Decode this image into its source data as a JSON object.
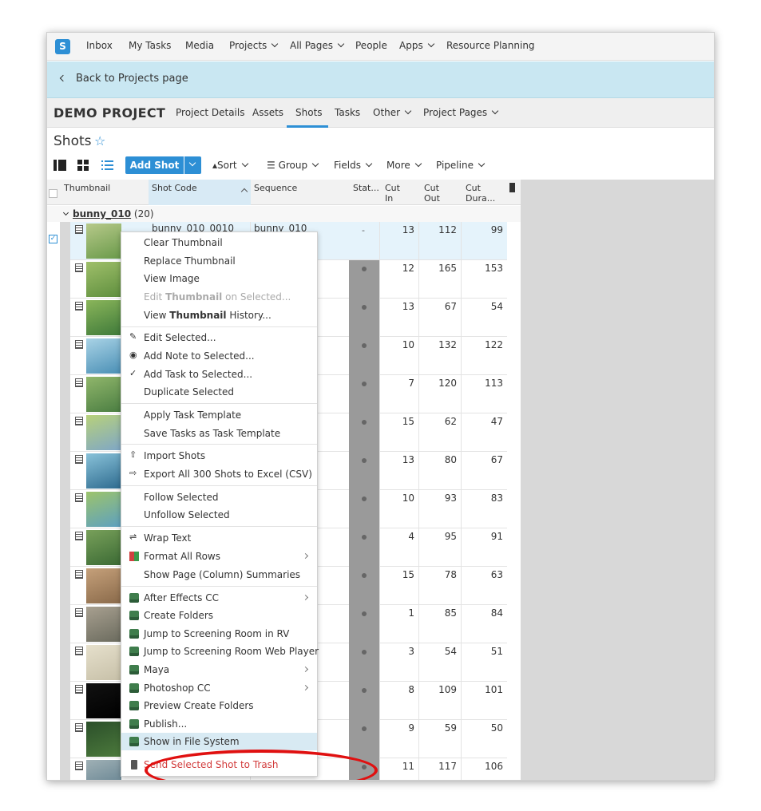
{
  "nav": {
    "logo": "S",
    "items": [
      "Inbox",
      "My Tasks",
      "Media",
      "Projects",
      "All Pages",
      "People",
      "Apps",
      "Resource Planning"
    ]
  },
  "back_bar": {
    "label": "Back to Projects page"
  },
  "project": {
    "title": "DEMO PROJECT",
    "tabs": [
      "Project Details",
      "Assets",
      "Shots",
      "Tasks",
      "Other",
      "Project Pages"
    ],
    "active_tab": "Shots"
  },
  "page": {
    "title": "Shots"
  },
  "toolbar": {
    "add_shot": "Add Shot",
    "sort": "Sort",
    "group": "Group",
    "fields": "Fields",
    "more": "More",
    "pipeline": "Pipeline"
  },
  "grid": {
    "columns": [
      "Thumbnail",
      "Shot Code",
      "Sequence",
      "Stat...",
      "Cut In",
      "Cut Out",
      "Cut Dura..."
    ],
    "column_header_lines": {
      "cut_in": [
        "Cut",
        "In"
      ],
      "cut_out": [
        "Cut",
        "Out"
      ],
      "cut_duration": [
        "Cut",
        "Dura..."
      ]
    },
    "group_name": "bunny_010",
    "group_count": "(20)",
    "first_row_shot_code": "bunny_010_0010",
    "first_row_sequence": "bunny_010",
    "first_row_status": "-",
    "rows": [
      {
        "cut_in": "13",
        "cut_out": "112",
        "cut_dur": "99"
      },
      {
        "cut_in": "12",
        "cut_out": "165",
        "cut_dur": "153"
      },
      {
        "cut_in": "13",
        "cut_out": "67",
        "cut_dur": "54"
      },
      {
        "cut_in": "10",
        "cut_out": "132",
        "cut_dur": "122"
      },
      {
        "cut_in": "7",
        "cut_out": "120",
        "cut_dur": "113"
      },
      {
        "cut_in": "15",
        "cut_out": "62",
        "cut_dur": "47"
      },
      {
        "cut_in": "13",
        "cut_out": "80",
        "cut_dur": "67"
      },
      {
        "cut_in": "10",
        "cut_out": "93",
        "cut_dur": "83"
      },
      {
        "cut_in": "4",
        "cut_out": "95",
        "cut_dur": "91"
      },
      {
        "cut_in": "15",
        "cut_out": "78",
        "cut_dur": "63"
      },
      {
        "cut_in": "1",
        "cut_out": "85",
        "cut_dur": "84"
      },
      {
        "cut_in": "3",
        "cut_out": "54",
        "cut_dur": "51"
      },
      {
        "cut_in": "8",
        "cut_out": "109",
        "cut_dur": "101"
      },
      {
        "cut_in": "9",
        "cut_out": "59",
        "cut_dur": "50"
      },
      {
        "cut_in": "11",
        "cut_out": "117",
        "cut_dur": "106"
      }
    ]
  },
  "context_menu": {
    "items": [
      {
        "label": "Clear Thumbnail"
      },
      {
        "label": "Replace Thumbnail"
      },
      {
        "label": "View Image"
      },
      {
        "label_parts": [
          "Edit ",
          "Thumbnail",
          " on Selected..."
        ]
      },
      {
        "label_parts": [
          "View ",
          "Thumbnail",
          " History..."
        ]
      },
      {
        "label": "Edit Selected..."
      },
      {
        "label": "Add Note to Selected..."
      },
      {
        "label": "Add Task to Selected..."
      },
      {
        "label": "Duplicate Selected"
      },
      {
        "label": "Apply Task Template"
      },
      {
        "label": "Save Tasks as Task Template"
      },
      {
        "label": "Import Shots"
      },
      {
        "label": "Export All 300 Shots to Excel (CSV)"
      },
      {
        "label": "Follow Selected"
      },
      {
        "label": "Unfollow Selected"
      },
      {
        "label": "Wrap Text"
      },
      {
        "label": "Format All Rows"
      },
      {
        "label": "Show Page (Column) Summaries"
      },
      {
        "label": "After Effects CC"
      },
      {
        "label": "Create Folders"
      },
      {
        "label": "Jump to Screening Room in RV"
      },
      {
        "label": "Jump to Screening Room Web Player"
      },
      {
        "label": "Maya"
      },
      {
        "label": "Photoshop CC"
      },
      {
        "label": "Preview Create Folders"
      },
      {
        "label": "Publish..."
      },
      {
        "label": "Show in File System"
      },
      {
        "label": "Send Selected Shot to Trash"
      }
    ],
    "highlighted": "Show in File System"
  },
  "colors": {
    "accent": "#2d8fd5",
    "back_bar": "#c9e7f2",
    "highlight_ring": "#e01010",
    "danger": "#d23b3b"
  }
}
